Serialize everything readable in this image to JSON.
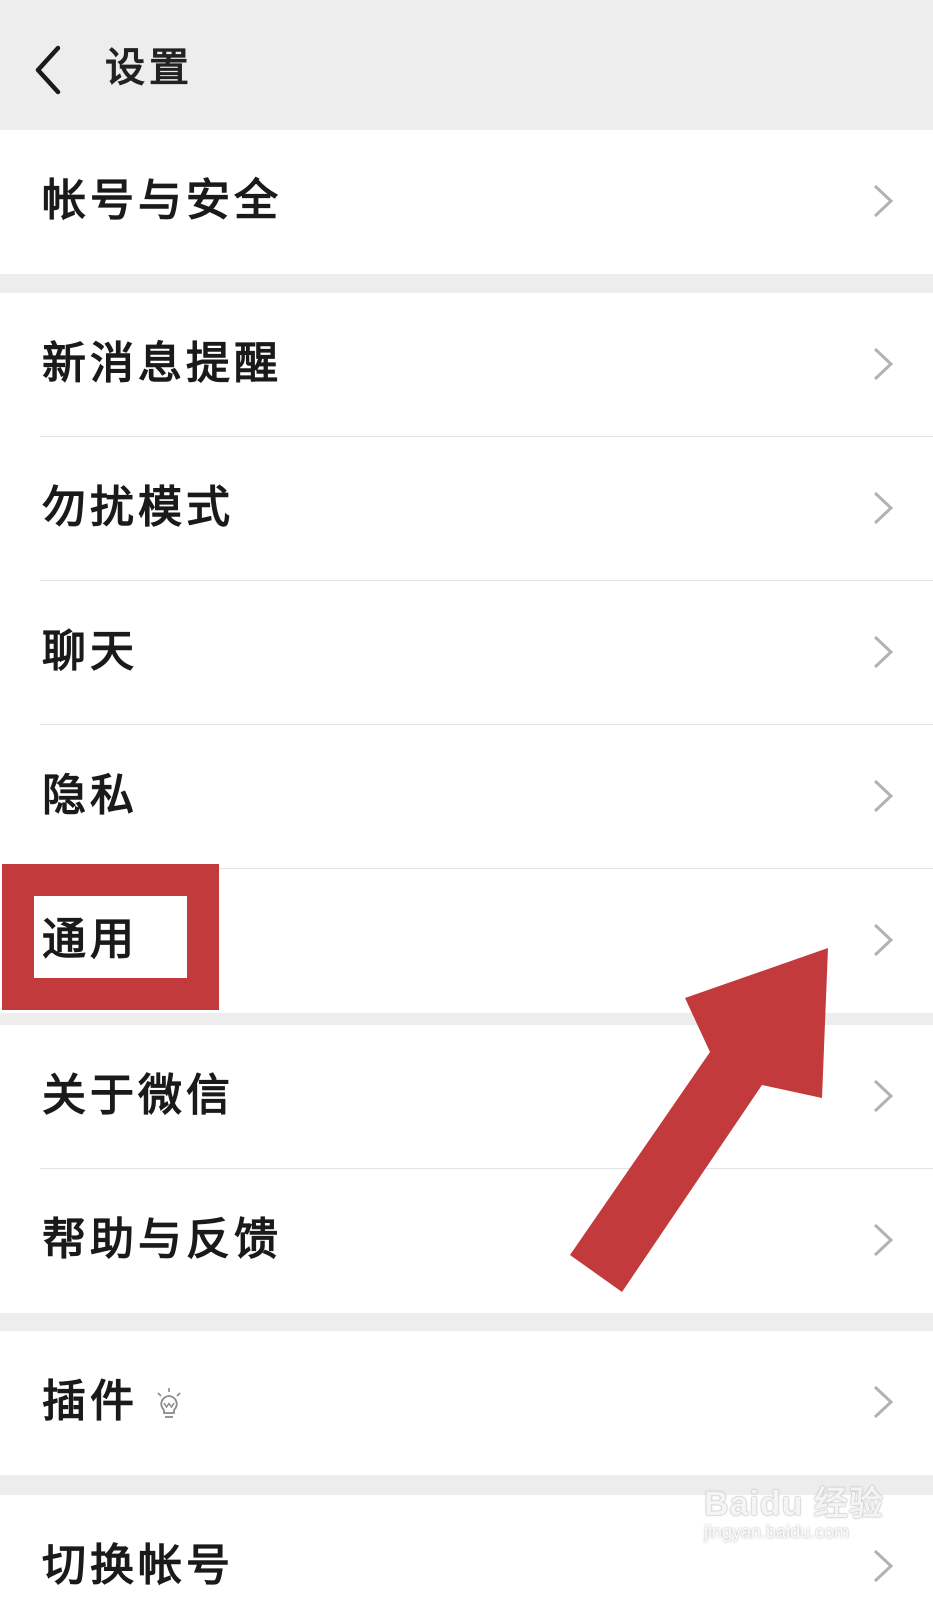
{
  "header": {
    "title": "设置"
  },
  "groups": [
    {
      "items": [
        {
          "label": "帐号与安全"
        }
      ]
    },
    {
      "items": [
        {
          "label": "新消息提醒"
        },
        {
          "label": "勿扰模式"
        },
        {
          "label": "聊天"
        },
        {
          "label": "隐私"
        },
        {
          "label": "通用"
        }
      ]
    },
    {
      "items": [
        {
          "label": "关于微信"
        },
        {
          "label": "帮助与反馈"
        }
      ]
    },
    {
      "items": [
        {
          "label": "插件",
          "icon": "lightbulb-icon"
        }
      ]
    },
    {
      "items": [
        {
          "label": "切换帐号"
        }
      ]
    }
  ],
  "annotation": {
    "highlight_color": "#c23a3b",
    "highlighted_item": "通用"
  },
  "watermark": {
    "main": "Baidu 经验",
    "sub": "jingyan.baidu.com"
  },
  "colors": {
    "background": "#ededed",
    "row_background": "#ffffff",
    "chevron": "#b2b2b2",
    "text": "#1a1a1a"
  }
}
